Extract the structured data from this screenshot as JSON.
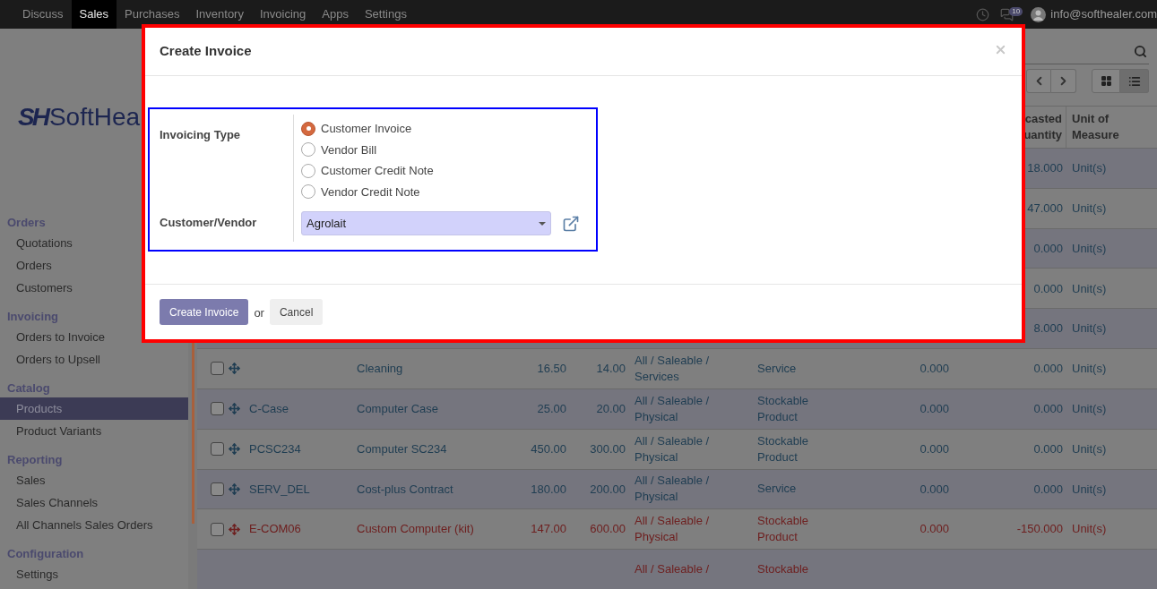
{
  "top_nav": {
    "apps": [
      {
        "label": "Discuss",
        "selected": false
      },
      {
        "label": "Sales",
        "selected": true
      },
      {
        "label": "Purchases",
        "selected": false
      },
      {
        "label": "Inventory",
        "selected": false
      },
      {
        "label": "Invoicing",
        "selected": false
      },
      {
        "label": "Apps",
        "selected": false
      },
      {
        "label": "Settings",
        "selected": false
      }
    ],
    "chat_count": "10",
    "user_email": "info@softhealer.com"
  },
  "sidebar": {
    "logo": {
      "mark": "SH",
      "text": "SoftHea"
    },
    "sections": [
      {
        "title": "Orders",
        "items": [
          {
            "label": "Quotations",
            "selected": false
          },
          {
            "label": "Orders",
            "selected": false
          },
          {
            "label": "Customers",
            "selected": false
          }
        ]
      },
      {
        "title": "Invoicing",
        "items": [
          {
            "label": "Orders to Invoice",
            "selected": false
          },
          {
            "label": "Orders to Upsell",
            "selected": false
          }
        ]
      },
      {
        "title": "Catalog",
        "items": [
          {
            "label": "Products",
            "selected": true
          },
          {
            "label": "Product Variants",
            "selected": false
          }
        ]
      },
      {
        "title": "Reporting",
        "items": [
          {
            "label": "Sales",
            "selected": false
          },
          {
            "label": "Sales Channels",
            "selected": false
          },
          {
            "label": "All Channels Sales Orders",
            "selected": false
          }
        ]
      },
      {
        "title": "Configuration",
        "items": [
          {
            "label": "Settings",
            "selected": false
          }
        ]
      }
    ]
  },
  "view_switcher": [
    {
      "kind": "kanban",
      "selected": false
    },
    {
      "kind": "list",
      "selected": true
    }
  ],
  "table": {
    "columns": [
      {
        "label": "casted uantity"
      },
      {
        "label": "Unit of Measure"
      }
    ],
    "rows": [
      {
        "forecast": "18.000",
        "uom": "Unit(s)"
      },
      {
        "forecast": "47.000",
        "uom": "Unit(s)"
      },
      {
        "forecast": "0.000",
        "uom": "Unit(s)"
      },
      {
        "forecast": "0.000",
        "uom": "Unit(s)"
      },
      {
        "forecast": "8.000",
        "uom": "Unit(s)"
      },
      {
        "checked": false,
        "alert": false,
        "name": "Cleaning",
        "price": "16.50",
        "cost": "14.00",
        "category": "All / Saleable / Services",
        "type": "Service",
        "on_hand": "0.000",
        "forecast": "0.000",
        "uom": "Unit(s)"
      },
      {
        "checked": false,
        "alert": false,
        "reference": "C-Case",
        "name": "Computer Case",
        "price": "25.00",
        "cost": "20.00",
        "category": "All / Saleable / Physical",
        "type": "Stockable Product",
        "on_hand": "0.000",
        "forecast": "0.000",
        "uom": "Unit(s)"
      },
      {
        "checked": false,
        "alert": false,
        "reference": "PCSC234",
        "name": "Computer SC234",
        "price": "450.00",
        "cost": "300.00",
        "category": "All / Saleable / Physical",
        "type": "Stockable Product",
        "on_hand": "0.000",
        "forecast": "0.000",
        "uom": "Unit(s)"
      },
      {
        "checked": false,
        "alert": false,
        "reference": "SERV_DEL",
        "name": "Cost-plus Contract",
        "price": "180.00",
        "cost": "200.00",
        "category": "All / Saleable / Physical",
        "type": "Service",
        "on_hand": "0.000",
        "forecast": "0.000",
        "uom": "Unit(s)"
      },
      {
        "checked": false,
        "alert": true,
        "reference": "E-COM06",
        "name": "Custom Computer (kit)",
        "price": "147.00",
        "cost": "600.00",
        "category": "All / Saleable / Physical",
        "type": "Stockable Product",
        "on_hand": "0.000",
        "forecast": "-150.000",
        "uom": "Unit(s)"
      },
      {
        "alert": true,
        "category": "All / Saleable /",
        "type": "Stockable"
      }
    ]
  },
  "modal": {
    "title": "Create Invoice",
    "fields": [
      {
        "label": "Invoicing Type",
        "kind": "radio",
        "options": [
          {
            "label": "Customer Invoice",
            "selected": true
          },
          {
            "label": "Vendor Bill",
            "selected": false
          },
          {
            "label": "Customer Credit Note",
            "selected": false
          },
          {
            "label": "Vendor Credit Note",
            "selected": false
          }
        ]
      },
      {
        "label": "Customer/Vendor",
        "kind": "select",
        "value": "Agrolait"
      }
    ],
    "buttons": [
      {
        "label": "Create Invoice",
        "kind": "primary"
      },
      {
        "label": "Cancel",
        "kind": "secondary"
      }
    ],
    "separator": "or"
  }
}
